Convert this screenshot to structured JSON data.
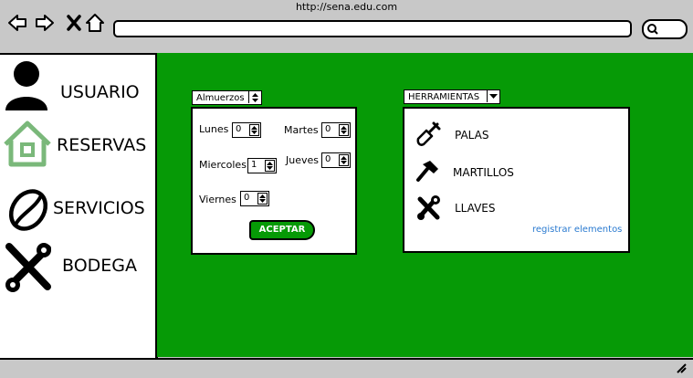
{
  "browser": {
    "url": "http://sena.edu.com"
  },
  "sidebar": {
    "items": [
      {
        "label": "USUARIO",
        "icon": "user-icon"
      },
      {
        "label": "RESERVAS",
        "icon": "home-icon"
      },
      {
        "label": "SERVICIOS",
        "icon": "coffee-bean-icon"
      },
      {
        "label": "BODEGA",
        "icon": "tools-icon"
      }
    ]
  },
  "lunch": {
    "select_value": "Almuerzos",
    "days": [
      {
        "label": "Lunes",
        "value": "0"
      },
      {
        "label": "Martes",
        "value": "0"
      },
      {
        "label": "Miercoles",
        "value": "1"
      },
      {
        "label": "Jueves",
        "value": "0"
      },
      {
        "label": "Viernes",
        "value": "0"
      }
    ],
    "accept_label": "ACEPTAR"
  },
  "tools": {
    "select_value": "HERRAMIENTAS",
    "items": [
      {
        "label": "PALAS",
        "icon": "shovel-icon"
      },
      {
        "label": "MARTILLOS",
        "icon": "hammer-icon"
      },
      {
        "label": "LLAVES",
        "icon": "wrench-icon"
      }
    ],
    "register_link": "registrar elementos"
  },
  "colors": {
    "main_bg": "#069a06",
    "chrome_bg": "#c8c8c8",
    "link": "#2a7ad0",
    "home_icon": "#7ab87a"
  }
}
